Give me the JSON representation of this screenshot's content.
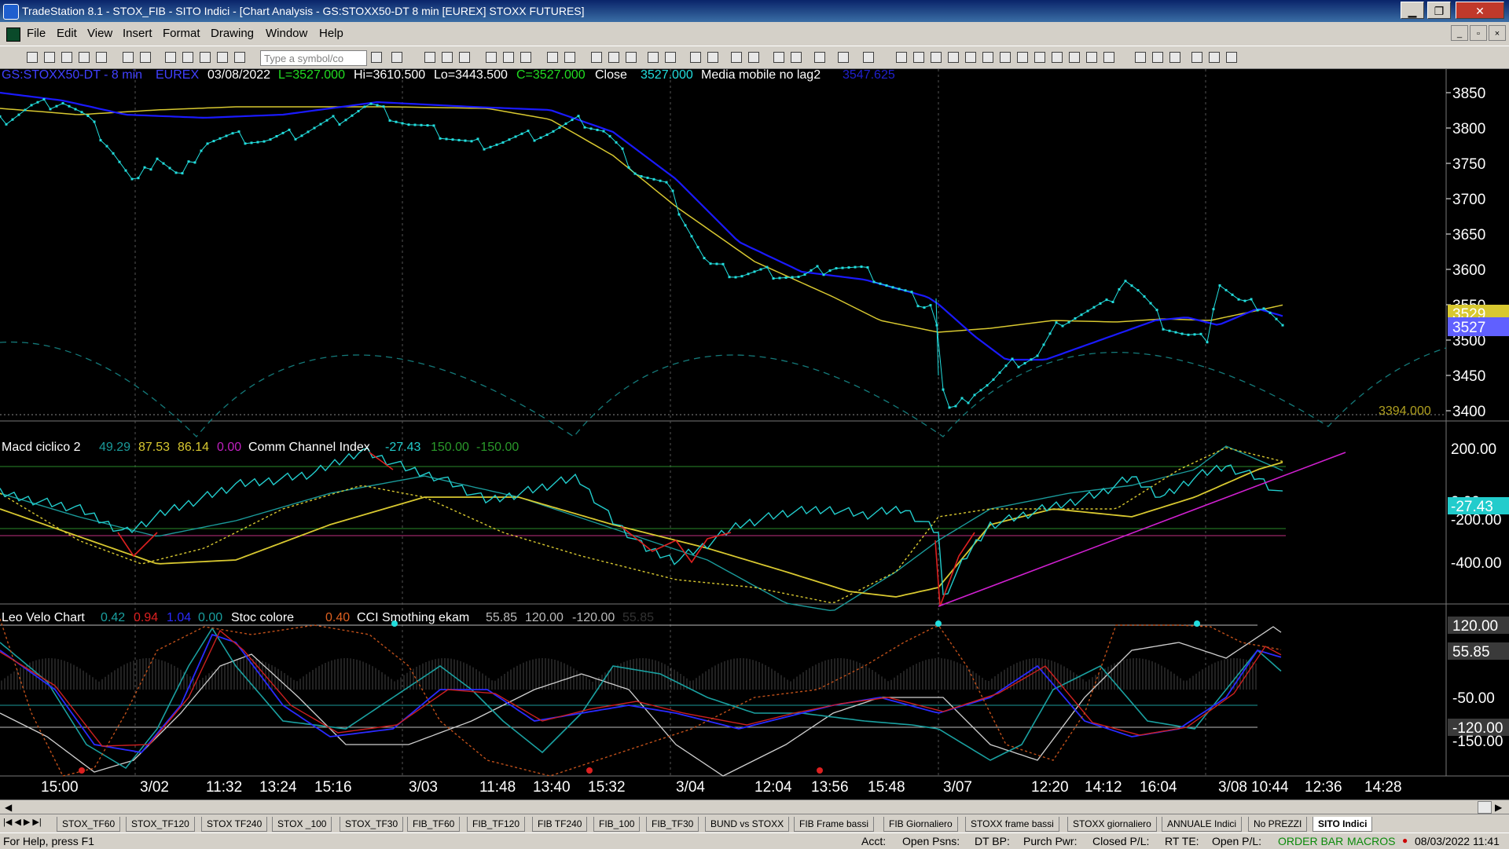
{
  "window": {
    "title": "TradeStation 8.1 - STOX_FIB - SITO Indici - [Chart Analysis - GS:STOXX50-DT  8 min  [EUREX] STOXX FUTURES]",
    "min": "▁",
    "max": "❐",
    "close": "✕"
  },
  "menu": [
    "File",
    "Edit",
    "View",
    "Insert",
    "Format",
    "Drawing",
    "Window",
    "Help"
  ],
  "toolbar": {
    "symbol_placeholder": "Type a symbol/co"
  },
  "price_panel": {
    "symbol": "GS:STOXX50-DT - 8 min",
    "exchange": "EUREX",
    "date": "03/08/2022",
    "last": "L=3527.000",
    "high": "Hi=3610.500",
    "low": "Lo=3443.500",
    "close_val": "C=3527.000",
    "close_label": "Close",
    "close_num": "3527.000",
    "ma_label": "Media mobile no lag2",
    "ma_value": "3547.625",
    "level_label": "3394.000",
    "axis": [
      "3850",
      "3800",
      "3750",
      "3700",
      "3650",
      "3600",
      "3550",
      "3500",
      "3450",
      "3400"
    ],
    "last_tag": "3527",
    "ma_tag": "3529"
  },
  "macd_panel": {
    "name": "Macd ciclico 2",
    "v1": "49.29",
    "v2": "87.53",
    "v3": "86.14",
    "v4": "0.00",
    "cci_name": "Comm Channel Index",
    "cci_val": "-27.43",
    "cci_hi": "150.00",
    "cci_lo": "-150.00",
    "axis": [
      "200.00",
      "0.00",
      "-200.00",
      "-400.00"
    ],
    "tag": "-27.43"
  },
  "velo_panel": {
    "name": "Leo Velo Chart",
    "v1": "0.42",
    "v2": "0.94",
    "v3": "1.04",
    "v4": "0.00",
    "stoc_name": "Stoc colore",
    "stoc_val": "0.40",
    "cci_name": "CCI Smothing ekam",
    "cci_val": "55.85",
    "cci_hi": "120.00",
    "cci_lo": "-120.00",
    "cci_dim": "55.85",
    "axis": [
      "120.00",
      "55.85",
      "-50.00",
      "-120.00",
      "-150.00"
    ]
  },
  "time_axis": [
    "15:00",
    "3/02",
    "11:32",
    "13:24",
    "15:16",
    "3/03",
    "11:48",
    "13:40",
    "15:32",
    "3/04",
    "12:04",
    "13:56",
    "15:48",
    "3/07",
    "12:20",
    "14:12",
    "16:04",
    "3/08",
    "10:44",
    "12:36",
    "14:28"
  ],
  "tabs": [
    "STOX_TF60",
    "STOX_TF120",
    "STOX TF240",
    "STOX _100",
    "STOX_TF30",
    "FIB_TF60",
    "FIB_TF120",
    "FIB TF240",
    "FIB_100",
    "FIB_TF30",
    "BUND vs STOXX",
    "FIB Frame bassi",
    "FIB Giornaliero",
    "STOXX frame bassi",
    "STOXX giornaliero",
    "ANNUALE Indici",
    "No PREZZI",
    "SITO Indici"
  ],
  "status": {
    "help": "For Help, press F1",
    "acct": "Acct:",
    "open_psns": "Open Psns:",
    "dt_bp": "DT BP:",
    "purch": "Purch Pwr:",
    "closed_pl": "Closed P/L:",
    "rt_te": "RT TE:",
    "open_pl": "Open P/L:",
    "order_bar": "ORDER BAR",
    "macros": "MACROS",
    "datetime": "08/03/2022 11:41"
  },
  "colors": {
    "price_dots": "#22dddd",
    "ma_blue": "#1a1aff",
    "ma_yellow": "#d8c830",
    "magenta": "#d020d0"
  }
}
